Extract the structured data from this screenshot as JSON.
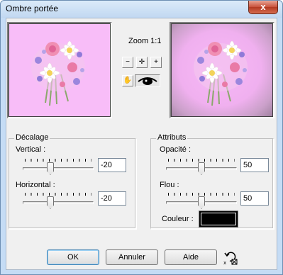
{
  "window": {
    "title": "Ombre portée",
    "close_glyph": "x"
  },
  "preview": {
    "zoom_label": "Zoom 1:1",
    "tools": [
      "zoom-out-icon",
      "pan-move-icon",
      "zoom-in-icon",
      "hand-icon",
      "eye-icon"
    ]
  },
  "offset": {
    "legend": "Décalage",
    "vertical": {
      "label": "Vertical :",
      "value": "-20",
      "slider_fraction": 0.38
    },
    "horizontal": {
      "label": "Horizontal :",
      "value": "-20",
      "slider_fraction": 0.38
    }
  },
  "attributes": {
    "legend": "Attributs",
    "opacity": {
      "label": "Opacité :",
      "value": "50",
      "slider_fraction": 0.5
    },
    "blur": {
      "label": "Flou :",
      "value": "50",
      "slider_fraction": 0.5
    },
    "color": {
      "label": "Couleur :",
      "value": "#000000"
    }
  },
  "buttons": {
    "ok": "OK",
    "cancel": "Annuler",
    "help": "Aide"
  },
  "colors": {
    "preview_bg": "#f8bdf8",
    "titlebar": "#c5dcf5",
    "close": "#c8513a"
  }
}
